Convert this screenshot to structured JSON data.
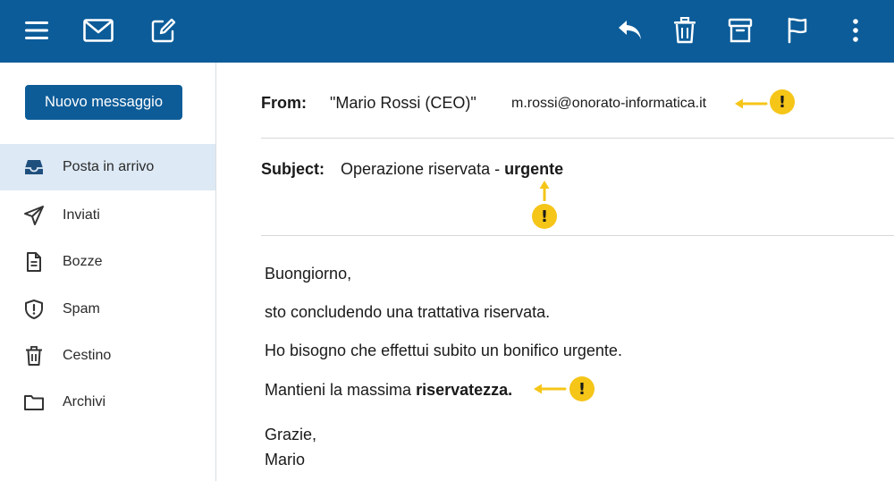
{
  "toolbar": {
    "icons": [
      "menu-icon",
      "mail-icon",
      "compose-icon",
      "reply-icon",
      "trash-icon",
      "archive-icon",
      "flag-icon",
      "more-icon"
    ],
    "color": "#0b5c99"
  },
  "sidebar": {
    "compose_label": "Nuovo messaggio",
    "items": [
      {
        "label": "Posta in arrivo",
        "icon": "inbox-icon",
        "active": true
      },
      {
        "label": "Inviati",
        "icon": "send-icon"
      },
      {
        "label": "Bozze",
        "icon": "draft-icon"
      },
      {
        "label": "Spam",
        "icon": "spam-shield-icon"
      },
      {
        "label": "Cestino",
        "icon": "trash-icon"
      },
      {
        "label": "Archivi",
        "icon": "folder-icon"
      }
    ]
  },
  "email": {
    "from_label": "From:",
    "from_name": "\"Mario Rossi (CEO)\"",
    "from_address": "m.rossi@onorato-informatica.it",
    "subject_label": "Subject:",
    "subject_text": "Operazione riservata - ",
    "subject_bold": "urgente",
    "body": {
      "greeting": "Buongiorno,",
      "line1": "sto concludendo una trattativa riservata.",
      "line2": "Ho bisogno che effettui subito un bonifico urgente.",
      "line3_text": "Mantieni la massima ",
      "line3_bold": "riservatezza.",
      "closing": "Grazie,",
      "signature": "Mario"
    }
  },
  "warnings": {
    "symbol": "!",
    "color": "#f5c518"
  }
}
